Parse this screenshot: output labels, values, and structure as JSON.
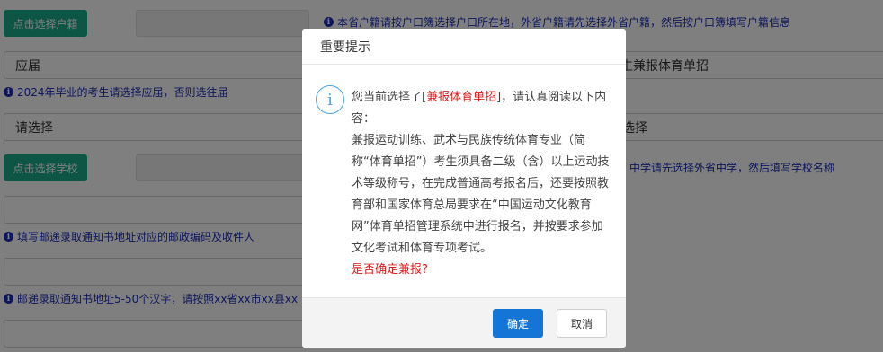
{
  "form": {
    "select_huji_button": "点击选择户籍",
    "huji_hint": "本省户籍请按户口簿选择户口所在地，外省户籍请先选择外省户籍，然后按户口簿填写户籍信息",
    "graduation_value": "应届",
    "sports_value": "考生兼报体育单招",
    "graduation_hint": "2024年毕业的考生请选择应届，否则选往届",
    "select_placeholder_left": "请选择",
    "select_placeholder_right": "选择",
    "select_school_button": "点击选择学校",
    "school_hint": "中学请先选择外省中学，然后填写学校名称",
    "postcode_hint": "填写邮递录取通知书地址对应的邮政编码及收件人",
    "address_hint": "邮递录取通知书地址5-50个汉字，请按照xx省xx市xx县xx"
  },
  "modal": {
    "title": "重要提示",
    "info_icon_glyph": "i",
    "msg_prefix": "您当前选择了[",
    "msg_highlight": "兼报体育单招",
    "msg_suffix": "]，请认真阅读以下内容：",
    "msg_body": "兼报运动训练、武术与民族传统体育专业（简称“体育单招”）考生须具备二级（含）以上运动技术等级称号，在完成普通高考报名后，还要按照教育部和国家体育总局要求在“中国运动文化教育网”体育单招管理系统中进行报名，并按要求参加文化考试和体育专项考试。",
    "msg_confirm": "是否确定兼报?",
    "confirm_label": "确定",
    "cancel_label": "取消"
  },
  "colors": {
    "overlay": "rgba(0,0,0,0.5)",
    "green_button": "#1aab8a",
    "hint_blue": "#1c2fb8",
    "primary_blue": "#1475d6",
    "highlight_red": "#e01b1b"
  }
}
